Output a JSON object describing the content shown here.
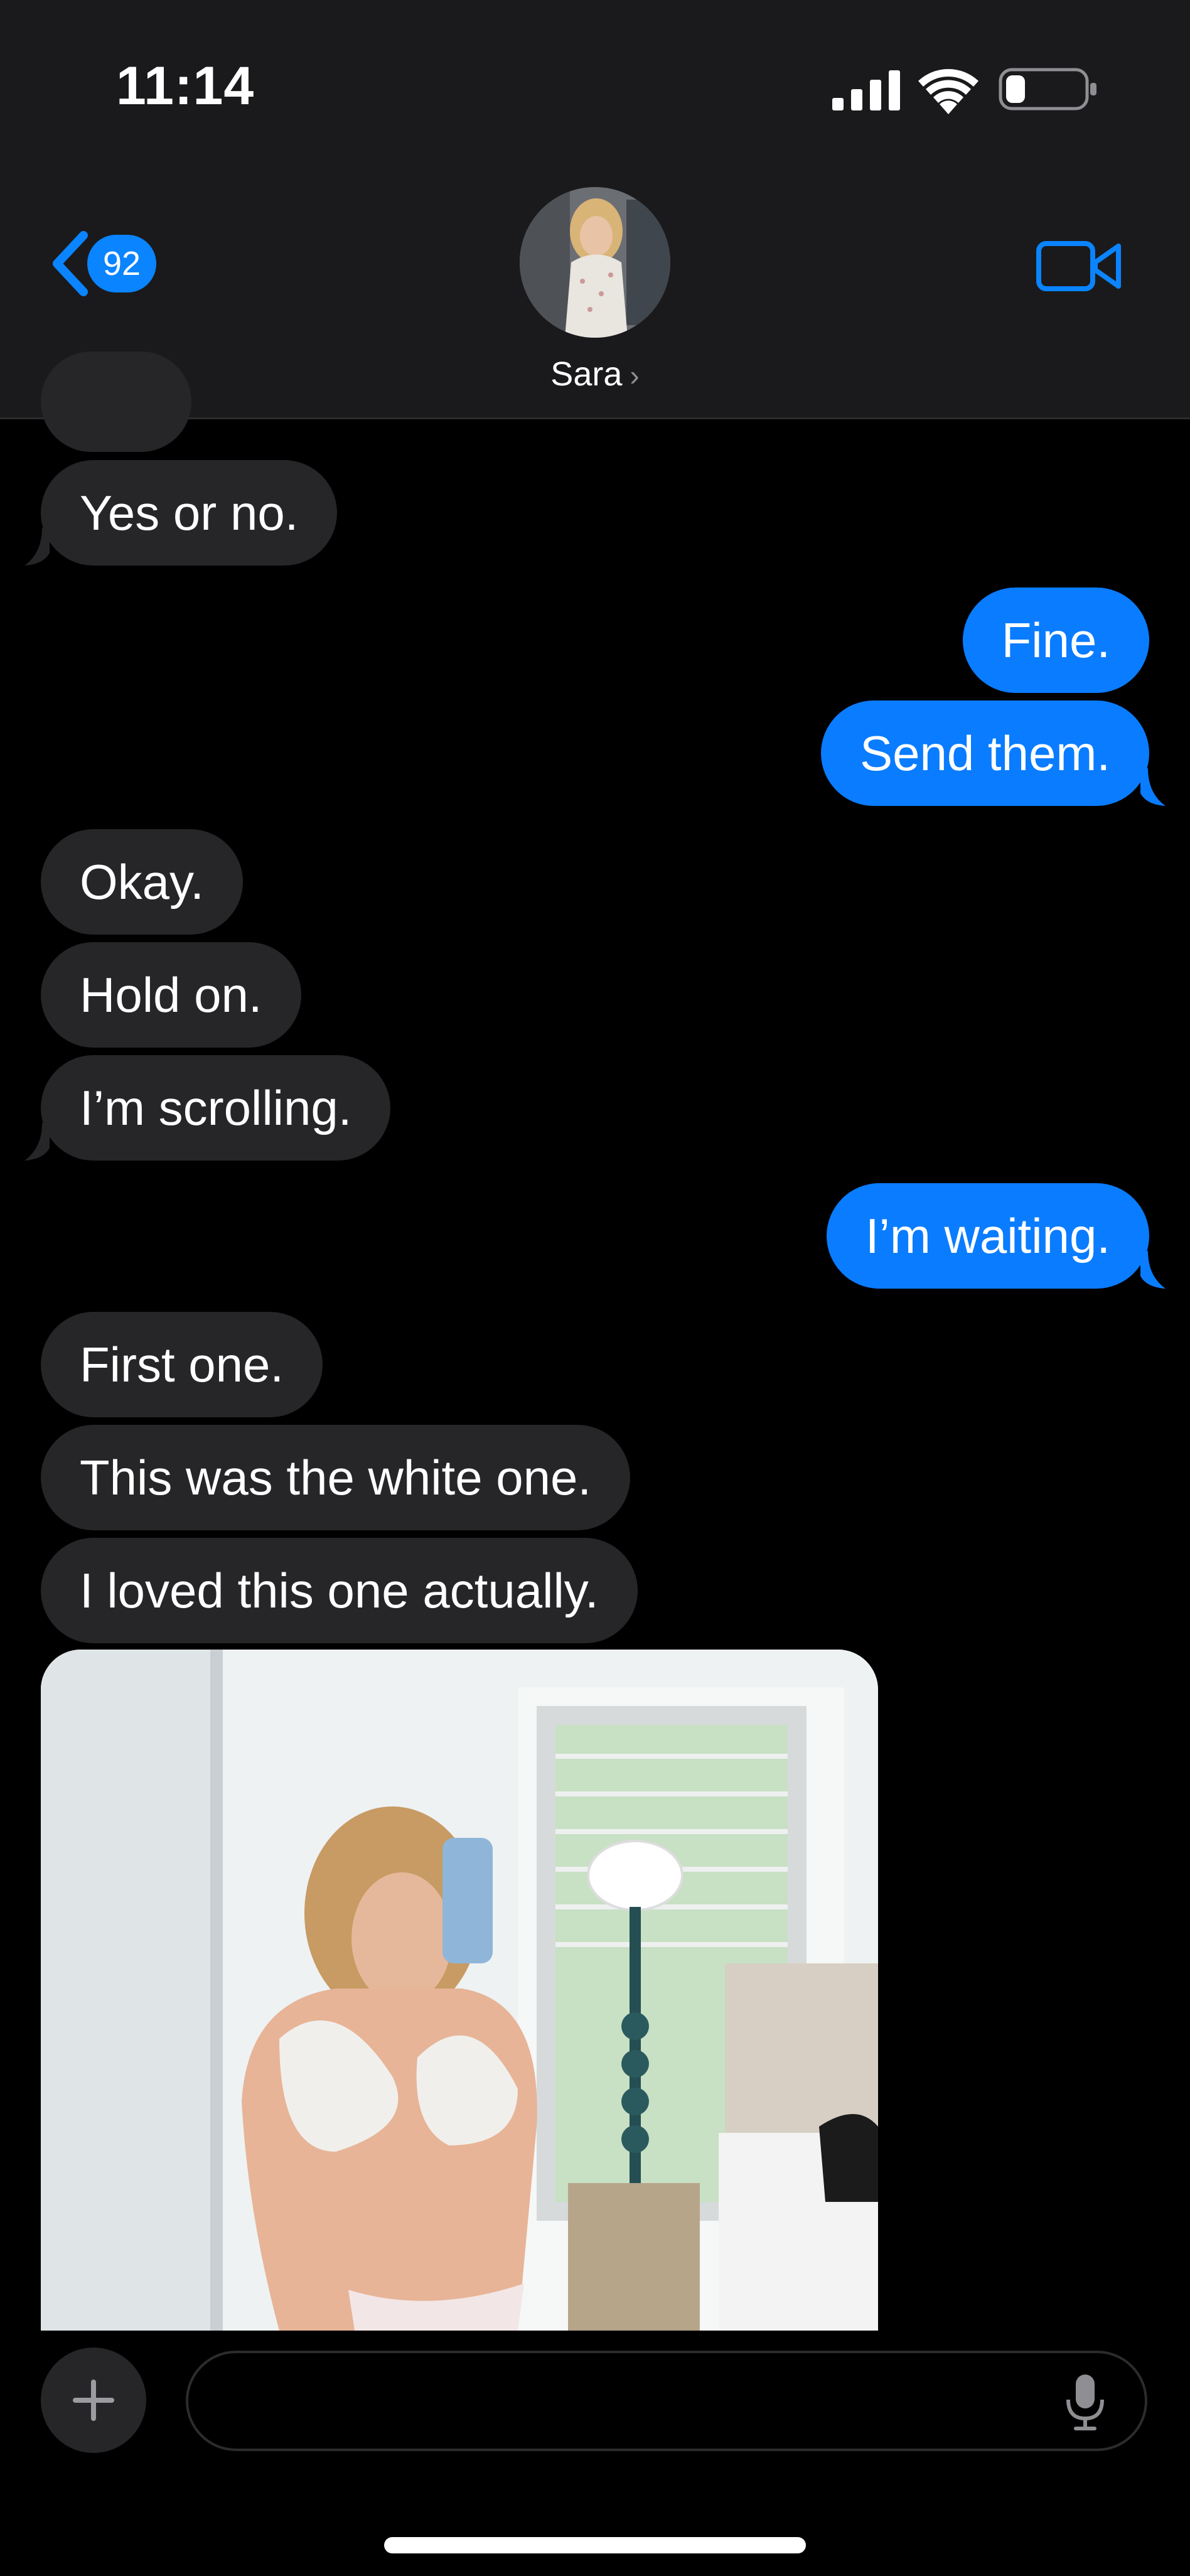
{
  "status_bar": {
    "time": "11:14",
    "signal_icon": "cellular-signal-icon",
    "wifi_icon": "wifi-icon",
    "battery_icon": "battery-icon",
    "battery_level": 0.25
  },
  "header": {
    "back_icon": "chevron-left-icon",
    "unread_count": "92",
    "contact_name": "Sara",
    "contact_chevron": "›",
    "video_icon": "video-camera-icon"
  },
  "messages": [
    {
      "from": "them",
      "text": "Yes or no."
    },
    {
      "from": "me",
      "text": "Fine."
    },
    {
      "from": "me",
      "text": "Send them."
    },
    {
      "from": "them",
      "text": "Okay."
    },
    {
      "from": "them",
      "text": "Hold on."
    },
    {
      "from": "them",
      "text": "I’m scrolling."
    },
    {
      "from": "me",
      "text": "I’m waiting."
    },
    {
      "from": "them",
      "text": "First one."
    },
    {
      "from": "them",
      "text": "This was the white one."
    },
    {
      "from": "them",
      "text": "I loved this one actually."
    }
  ],
  "compose": {
    "add_icon": "plus-icon",
    "placeholder": "",
    "mic_icon": "microphone-icon"
  },
  "colors": {
    "header_bg": "#1a1a1c",
    "sent_bubble": "#0a7cff",
    "received_bubble": "#262629",
    "accent": "#0a84ff"
  }
}
